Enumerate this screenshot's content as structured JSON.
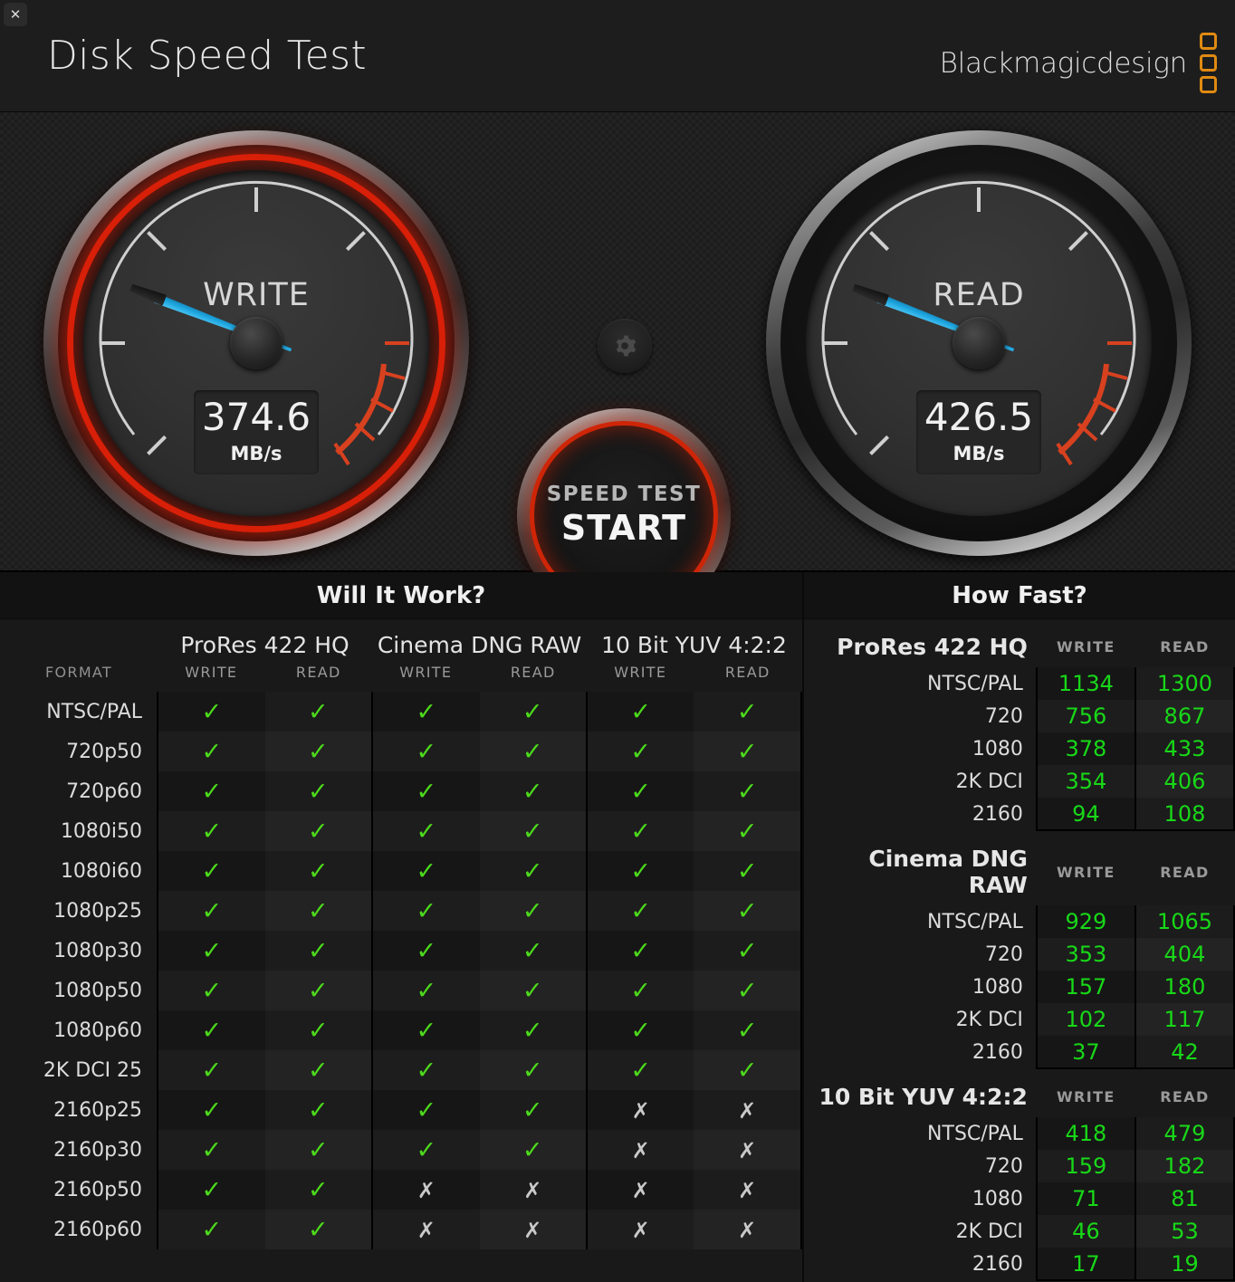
{
  "window": {
    "close_label": "✕",
    "title": "Disk Speed Test",
    "brand": "Blackmagicdesign",
    "brand_color": "#e08a12"
  },
  "gauges": {
    "write": {
      "label": "WRITE",
      "value": "374.6",
      "unit": "MB/s",
      "angle_deg": 201
    },
    "read": {
      "label": "READ",
      "value": "426.5",
      "unit": "MB/s",
      "angle_deg": 201
    },
    "needle_color": "#1fa7e0",
    "redline_color": "#d81f08"
  },
  "start_button": {
    "sub_label": "SPEED TEST",
    "main_label": "START"
  },
  "settings_button": {
    "icon": "gear-icon"
  },
  "will_it_work": {
    "title": "Will It Work?",
    "format_header": "FORMAT",
    "codec_groups": [
      {
        "name": "ProRes 422 HQ",
        "write_label": "WRITE",
        "read_label": "READ"
      },
      {
        "name": "Cinema DNG RAW",
        "write_label": "WRITE",
        "read_label": "READ"
      },
      {
        "name": "10 Bit YUV 4:2:2",
        "write_label": "WRITE",
        "read_label": "READ"
      }
    ],
    "pass_glyph": "✓",
    "fail_glyph": "✗",
    "rows": [
      {
        "format": "NTSC/PAL",
        "cells": [
          true,
          true,
          true,
          true,
          true,
          true
        ]
      },
      {
        "format": "720p50",
        "cells": [
          true,
          true,
          true,
          true,
          true,
          true
        ]
      },
      {
        "format": "720p60",
        "cells": [
          true,
          true,
          true,
          true,
          true,
          true
        ]
      },
      {
        "format": "1080i50",
        "cells": [
          true,
          true,
          true,
          true,
          true,
          true
        ]
      },
      {
        "format": "1080i60",
        "cells": [
          true,
          true,
          true,
          true,
          true,
          true
        ]
      },
      {
        "format": "1080p25",
        "cells": [
          true,
          true,
          true,
          true,
          true,
          true
        ]
      },
      {
        "format": "1080p30",
        "cells": [
          true,
          true,
          true,
          true,
          true,
          true
        ]
      },
      {
        "format": "1080p50",
        "cells": [
          true,
          true,
          true,
          true,
          true,
          true
        ]
      },
      {
        "format": "1080p60",
        "cells": [
          true,
          true,
          true,
          true,
          true,
          true
        ]
      },
      {
        "format": "2K DCI 25",
        "cells": [
          true,
          true,
          true,
          true,
          true,
          true
        ]
      },
      {
        "format": "2160p25",
        "cells": [
          true,
          true,
          true,
          true,
          false,
          false
        ]
      },
      {
        "format": "2160p30",
        "cells": [
          true,
          true,
          true,
          true,
          false,
          false
        ]
      },
      {
        "format": "2160p50",
        "cells": [
          true,
          true,
          false,
          false,
          false,
          false
        ]
      },
      {
        "format": "2160p60",
        "cells": [
          true,
          true,
          false,
          false,
          false,
          false
        ]
      }
    ]
  },
  "how_fast": {
    "title": "How Fast?",
    "write_label": "WRITE",
    "read_label": "READ",
    "value_color": "#18d818",
    "groups": [
      {
        "name": "ProRes 422 HQ",
        "rows": [
          {
            "format": "NTSC/PAL",
            "write": "1134",
            "read": "1300"
          },
          {
            "format": "720",
            "write": "756",
            "read": "867"
          },
          {
            "format": "1080",
            "write": "378",
            "read": "433"
          },
          {
            "format": "2K DCI",
            "write": "354",
            "read": "406"
          },
          {
            "format": "2160",
            "write": "94",
            "read": "108"
          }
        ]
      },
      {
        "name": "Cinema DNG RAW",
        "rows": [
          {
            "format": "NTSC/PAL",
            "write": "929",
            "read": "1065"
          },
          {
            "format": "720",
            "write": "353",
            "read": "404"
          },
          {
            "format": "1080",
            "write": "157",
            "read": "180"
          },
          {
            "format": "2K DCI",
            "write": "102",
            "read": "117"
          },
          {
            "format": "2160",
            "write": "37",
            "read": "42"
          }
        ]
      },
      {
        "name": "10 Bit YUV 4:2:2",
        "rows": [
          {
            "format": "NTSC/PAL",
            "write": "418",
            "read": "479"
          },
          {
            "format": "720",
            "write": "159",
            "read": "182"
          },
          {
            "format": "1080",
            "write": "71",
            "read": "81"
          },
          {
            "format": "2K DCI",
            "write": "46",
            "read": "53"
          },
          {
            "format": "2160",
            "write": "17",
            "read": "19"
          }
        ]
      }
    ]
  }
}
